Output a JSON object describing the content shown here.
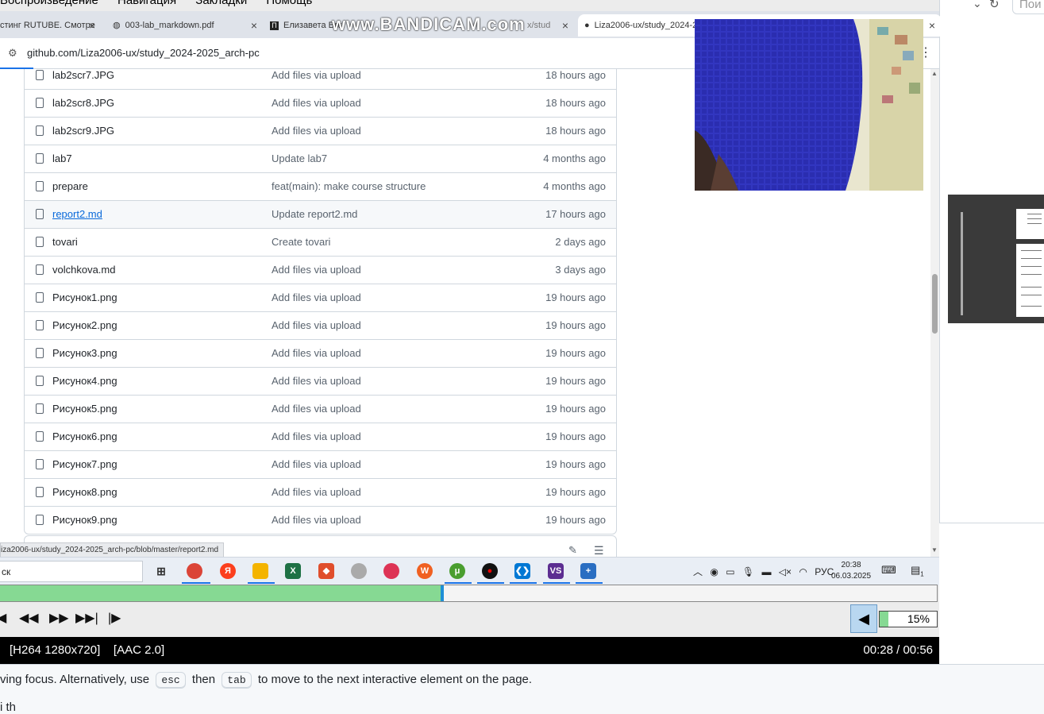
{
  "background_page": {
    "hint_before": "ving focus. Alternatively, use",
    "kbd_esc": "esc",
    "hint_middle": "then",
    "kbd_tab": "tab",
    "hint_after": "to move to the next interactive element on the page.",
    "hint2": "i th",
    "search_placeholder": "Пои"
  },
  "player": {
    "menu": [
      "Воспроизведение",
      "Навигация",
      "Закладки",
      "Помощь"
    ],
    "seek_progress": 0.47,
    "volume_percent": 0.15,
    "volume_label": "15%",
    "codec": "[H264 1280x720]    [AAC 2.0]",
    "time": "00:28 / 00:56",
    "watermark": "www.BANDICAM.com"
  },
  "browser": {
    "tabs": [
      {
        "label": "стинг RUTUBE. Смотре",
        "close": "×"
      },
      {
        "label": "003-lab_markdown.pdf",
        "close": "×"
      },
      {
        "label": "Елизавета Вол",
        "close": "×"
      },
      {
        "label": "x/stud",
        "close": "×"
      },
      {
        "label": "Liza2006-ux/study_2024-20",
        "close": "×"
      }
    ],
    "url": "github.com/Liza2006-ux/study_2024-2025_arch-pc",
    "status_url": "iza2006-ux/study_2024-2025_arch-pc/blob/master/report2.md"
  },
  "files": [
    {
      "name": "lab2scr7.JPG",
      "message": "Add files via upload",
      "date": "18 hours ago"
    },
    {
      "name": "lab2scr8.JPG",
      "message": "Add files via upload",
      "date": "18 hours ago"
    },
    {
      "name": "lab2scr9.JPG",
      "message": "Add files via upload",
      "date": "18 hours ago"
    },
    {
      "name": "lab7",
      "message": "Update lab7",
      "date": "4 months ago"
    },
    {
      "name": "prepare",
      "message": "feat(main): make course structure",
      "date": "4 months ago"
    },
    {
      "name": "report2.md",
      "message": "Update report2.md",
      "date": "17 hours ago"
    },
    {
      "name": "tovari",
      "message": "Create tovari",
      "date": "2 days ago"
    },
    {
      "name": "volchkova.md",
      "message": "Add files via upload",
      "date": "3 days ago"
    },
    {
      "name": "Рисунок1.png",
      "message": "Add files via upload",
      "date": "19 hours ago"
    },
    {
      "name": "Рисунок2.png",
      "message": "Add files via upload",
      "date": "19 hours ago"
    },
    {
      "name": "Рисунок3.png",
      "message": "Add files via upload",
      "date": "19 hours ago"
    },
    {
      "name": "Рисунок4.png",
      "message": "Add files via upload",
      "date": "19 hours ago"
    },
    {
      "name": "Рисунок5.png",
      "message": "Add files via upload",
      "date": "19 hours ago"
    },
    {
      "name": "Рисунок6.png",
      "message": "Add files via upload",
      "date": "19 hours ago"
    },
    {
      "name": "Рисунок7.png",
      "message": "Add files via upload",
      "date": "19 hours ago"
    },
    {
      "name": "Рисунок8.png",
      "message": "Add files via upload",
      "date": "19 hours ago"
    },
    {
      "name": "Рисунок9.png",
      "message": "Add files via upload",
      "date": "19 hours ago"
    }
  ],
  "taskbar": {
    "search_text": "ск",
    "language": "РУС",
    "time": "20:38",
    "date": "06.03.2025",
    "notifications": "1"
  }
}
